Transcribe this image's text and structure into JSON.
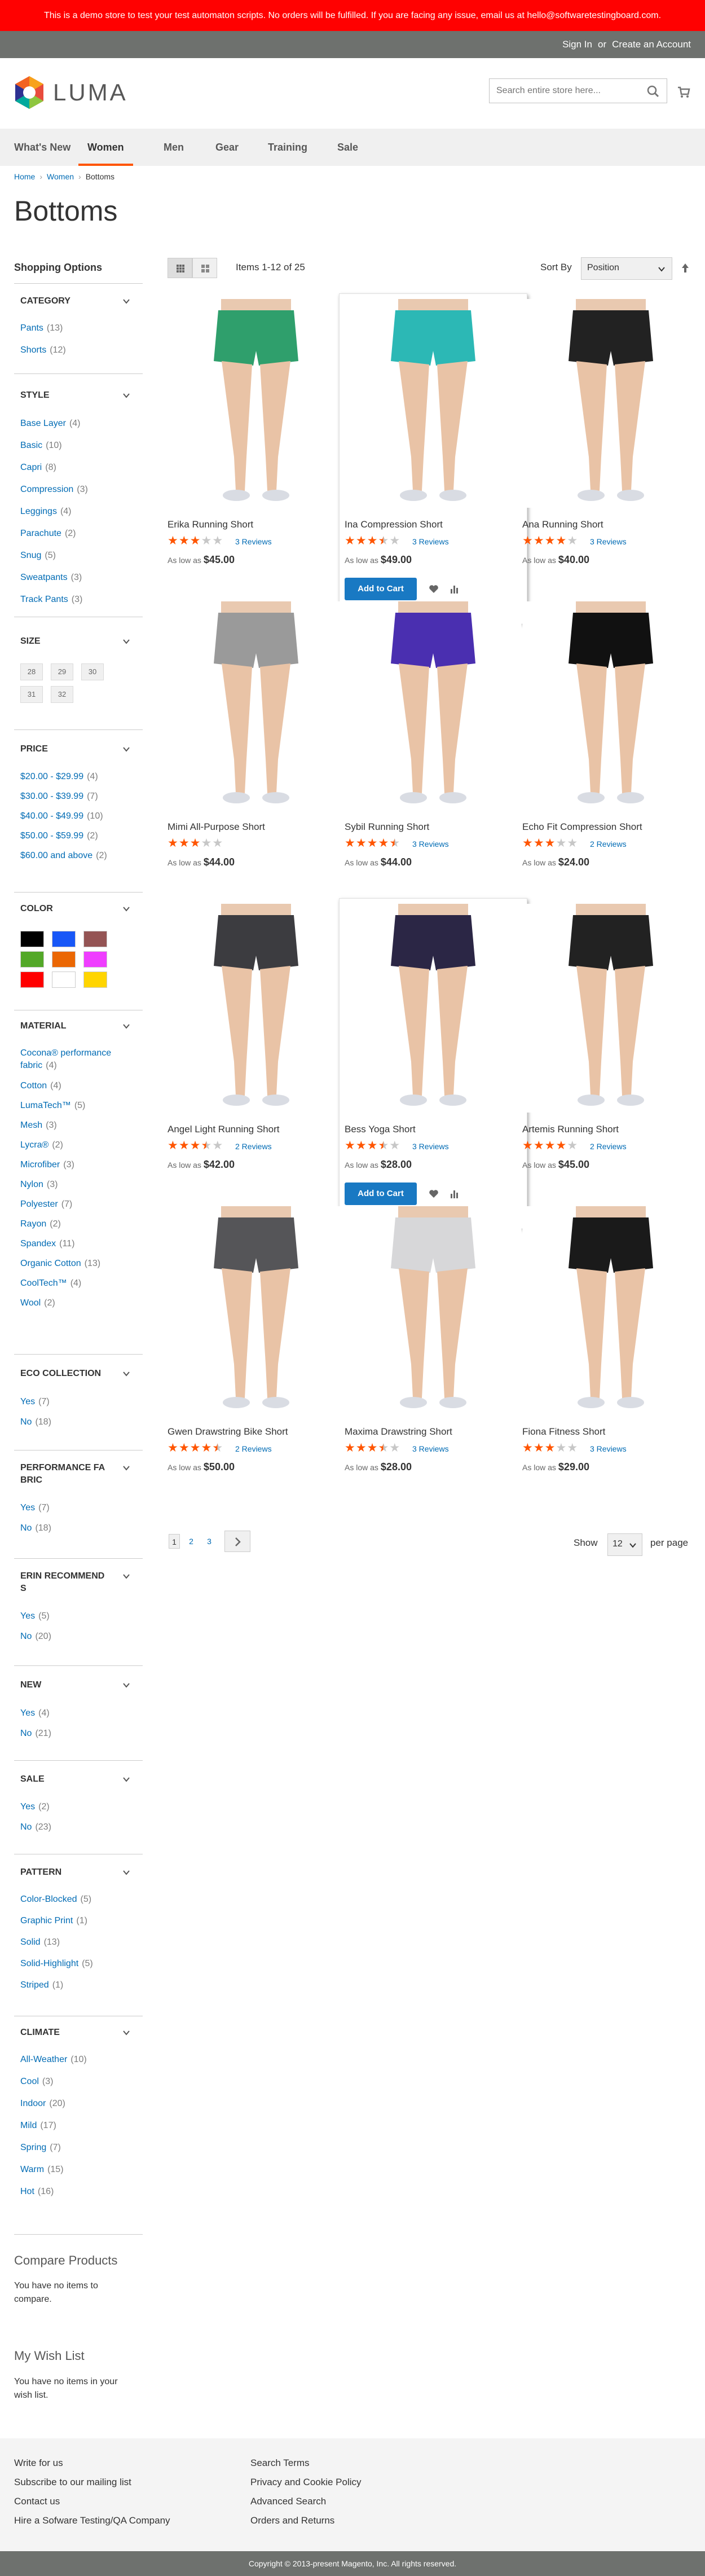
{
  "demo_notice": "This is a demo store to test your test automaton scripts. No orders will be fulfilled. If you are facing any issue, email us at hello@softwaretestingboard.com.",
  "header": {
    "sign_in": "Sign In",
    "or": "or",
    "create_account": "Create an Account",
    "logo_text": "LUMA",
    "search_placeholder": "Search entire store here..."
  },
  "nav": {
    "items": [
      "What's New",
      "Women",
      "Men",
      "Gear",
      "Training",
      "Sale"
    ],
    "active": "Women"
  },
  "breadcrumb": [
    "Home",
    "Women",
    "Bottoms"
  ],
  "page_title": "Bottoms",
  "shopping_options": "Shopping Options",
  "filters": {
    "category": {
      "title": "CATEGORY",
      "options": [
        {
          "label": "Pants",
          "count": "13"
        },
        {
          "label": "Shorts",
          "count": "12"
        }
      ]
    },
    "style": {
      "title": "STYLE",
      "options": [
        {
          "label": "Base Layer",
          "count": "4"
        },
        {
          "label": "Basic",
          "count": "10"
        },
        {
          "label": "Capri",
          "count": "8"
        },
        {
          "label": "Compression",
          "count": "3"
        },
        {
          "label": "Leggings",
          "count": "4"
        },
        {
          "label": "Parachute",
          "count": "2"
        },
        {
          "label": "Snug",
          "count": "5"
        },
        {
          "label": "Sweatpants",
          "count": "3"
        },
        {
          "label": "Track Pants",
          "count": "3"
        }
      ]
    },
    "size": {
      "title": "SIZE",
      "options": [
        "28",
        "29",
        "30",
        "31",
        "32"
      ]
    },
    "price": {
      "title": "PRICE",
      "options": [
        {
          "label": "$20.00 - $29.99",
          "count": "4"
        },
        {
          "label": "$30.00 - $39.99",
          "count": "7"
        },
        {
          "label": "$40.00 - $49.99",
          "count": "10"
        },
        {
          "label": "$50.00 - $59.99",
          "count": "2"
        },
        {
          "label": "$60.00 and above",
          "count": "2"
        }
      ]
    },
    "color": {
      "title": "COLOR",
      "swatches": [
        "#000000",
        "#1857f7",
        "#945454",
        "#53a828",
        "#eb6703",
        "#ef3dff",
        "#ff0000",
        "#ffffff",
        "#ffd500"
      ]
    },
    "material": {
      "title": "MATERIAL",
      "options": [
        {
          "label": "Cocona® performance fabric",
          "count": "4"
        },
        {
          "label": "Cotton",
          "count": "4"
        },
        {
          "label": "LumaTech™",
          "count": "5"
        },
        {
          "label": "Mesh",
          "count": "3"
        },
        {
          "label": "Lycra®",
          "count": "2"
        },
        {
          "label": "Microfiber",
          "count": "3"
        },
        {
          "label": "Nylon",
          "count": "3"
        },
        {
          "label": "Polyester",
          "count": "7"
        },
        {
          "label": "Rayon",
          "count": "2"
        },
        {
          "label": "Spandex",
          "count": "11"
        },
        {
          "label": "Organic Cotton",
          "count": "13"
        },
        {
          "label": "CoolTech™",
          "count": "4"
        },
        {
          "label": "Wool",
          "count": "2"
        }
      ]
    },
    "eco": {
      "title": "ECO COLLECTION",
      "options": [
        {
          "label": "Yes",
          "count": "7"
        },
        {
          "label": "No",
          "count": "18"
        }
      ]
    },
    "performance": {
      "title_line1": "PERFORMANCE FA",
      "title_line2": "BRIC",
      "options": [
        {
          "label": "Yes",
          "count": "7"
        },
        {
          "label": "No",
          "count": "18"
        }
      ]
    },
    "erin": {
      "title_line1": "ERIN RECOMMEND",
      "title_line2": "S",
      "options": [
        {
          "label": "Yes",
          "count": "5"
        },
        {
          "label": "No",
          "count": "20"
        }
      ]
    },
    "new": {
      "title": "NEW",
      "options": [
        {
          "label": "Yes",
          "count": "4"
        },
        {
          "label": "No",
          "count": "21"
        }
      ]
    },
    "sale": {
      "title": "SALE",
      "options": [
        {
          "label": "Yes",
          "count": "2"
        },
        {
          "label": "No",
          "count": "23"
        }
      ]
    },
    "pattern": {
      "title": "PATTERN",
      "options": [
        {
          "label": "Color-Blocked",
          "count": "5"
        },
        {
          "label": "Graphic Print",
          "count": "1"
        },
        {
          "label": "Solid",
          "count": "13"
        },
        {
          "label": "Solid-Highlight",
          "count": "5"
        },
        {
          "label": "Striped",
          "count": "1"
        }
      ]
    },
    "climate": {
      "title": "CLIMATE",
      "options": [
        {
          "label": "All-Weather",
          "count": "10"
        },
        {
          "label": "Cool",
          "count": "3"
        },
        {
          "label": "Indoor",
          "count": "20"
        },
        {
          "label": "Mild",
          "count": "17"
        },
        {
          "label": "Spring",
          "count": "7"
        },
        {
          "label": "Warm",
          "count": "15"
        },
        {
          "label": "Hot",
          "count": "16"
        }
      ]
    }
  },
  "compare": {
    "title": "Compare Products",
    "text": "You have no items to compare."
  },
  "wishlist": {
    "title": "My Wish List",
    "text": "You have no items in your wish list."
  },
  "toolbar": {
    "items_text": "Items 1-12 of 25",
    "sort_label": "Sort By",
    "sort_value": "Position"
  },
  "products": [
    {
      "name": "Erika Running Short",
      "rating": 3,
      "reviews": "3 Reviews",
      "as_low": "As low as",
      "price": "$45.00",
      "top": "#2f9f6c",
      "bottom_color": "#2f9f6c"
    },
    {
      "name": "Ina Compression Short",
      "rating": 3.5,
      "reviews": "3 Reviews",
      "as_low": "As low as",
      "price": "$49.00",
      "top": "#2cb8b5",
      "bottom_color": "#2cb8b5"
    },
    {
      "name": "Ana Running Short",
      "rating": 4,
      "reviews": "3 Reviews",
      "as_low": "As low as",
      "price": "$40.00",
      "top": "#222222",
      "bottom_color": "#222222"
    },
    {
      "name": "Mimi All-Purpose Short",
      "rating": 3,
      "reviews": "",
      "as_low": "As low as",
      "price": "$44.00",
      "top": "#9a9a9a",
      "bottom_color": "#9a9a9a"
    },
    {
      "name": "Sybil Running Short",
      "rating": 4.5,
      "reviews": "3 Reviews",
      "as_low": "As low as",
      "price": "$44.00",
      "top": "#4a2fb0",
      "bottom_color": "#4a2fb0"
    },
    {
      "name": "Echo Fit Compression Short",
      "rating": 3,
      "reviews": "2 Reviews",
      "as_low": "As low as",
      "price": "$24.00",
      "top": "#111111",
      "bottom_color": "#111111"
    },
    {
      "name": "Angel Light Running Short",
      "rating": 3.5,
      "reviews": "2 Reviews",
      "as_low": "As low as",
      "price": "$42.00",
      "top": "#3c3c40",
      "bottom_color": "#3c3c40"
    },
    {
      "name": "Bess Yoga Short",
      "rating": 3.5,
      "reviews": "3 Reviews",
      "as_low": "As low as",
      "price": "$28.00",
      "top": "#2b2645",
      "bottom_color": "#2b2645"
    },
    {
      "name": "Artemis Running Short",
      "rating": 4,
      "reviews": "2 Reviews",
      "as_low": "As low as",
      "price": "$45.00",
      "top": "#222222",
      "bottom_color": "#222222"
    },
    {
      "name": "Gwen Drawstring Bike Short",
      "rating": 4.5,
      "reviews": "2 Reviews",
      "as_low": "As low as",
      "price": "$50.00",
      "top": "#555558",
      "bottom_color": "#555558"
    },
    {
      "name": "Maxima Drawstring Short",
      "rating": 3.5,
      "reviews": "3 Reviews",
      "as_low": "As low as",
      "price": "$28.00",
      "top": "#d7d7d9",
      "bottom_color": "#d7d7d9"
    },
    {
      "name": "Fiona Fitness Short",
      "rating": 3,
      "reviews": "3 Reviews",
      "as_low": "As low as",
      "price": "$29.00",
      "top": "#1a1a1a",
      "bottom_color": "#1a1a1a"
    }
  ],
  "product_actions": {
    "add_to_cart": "Add to Cart"
  },
  "pager": {
    "pages": [
      "1",
      "2",
      "3"
    ],
    "show": "Show",
    "limit": "12",
    "per_page": "per page"
  },
  "footer": {
    "col1": [
      "Write for us",
      "Subscribe to our mailing list",
      "Contact us",
      "Hire a Sofware Testing/QA Company"
    ],
    "col2": [
      "Search Terms",
      "Privacy and Cookie Policy",
      "Advanced Search",
      "Orders and Returns"
    ],
    "copyright": "Copyright © 2013-present Magento, Inc. All rights reserved."
  },
  "colors": {
    "accent": "#ff5501",
    "link": "#006bb4",
    "button": "#1979c3",
    "notice": "#ff0101"
  }
}
